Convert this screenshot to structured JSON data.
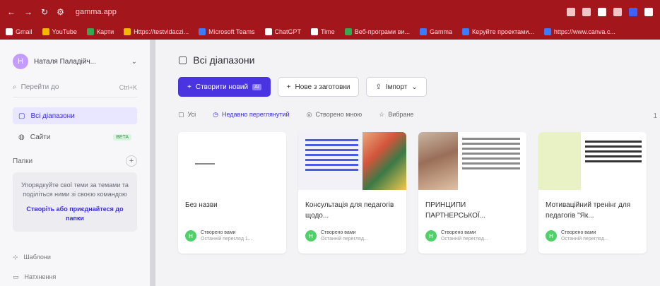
{
  "browser": {
    "tab_title": "gamma.app",
    "bookmarks": [
      "Gmail",
      "YouTube",
      "Карти",
      "Https://testvidaczi...",
      "Microsoft Teams",
      "ChatGPT",
      "Time",
      "Веб-програми ви...",
      "Gamma",
      "Керуйте проектами...",
      "https://www.canva.c..."
    ]
  },
  "sidebar": {
    "user_initial": "Н",
    "user_name": "Наталя Паладійч...",
    "search_placeholder": "Перейти до",
    "search_shortcut": "Ctrl+K",
    "nav": [
      {
        "label": "Всі діапазони",
        "active": true
      },
      {
        "label": "Сайти",
        "badge": "BETA"
      }
    ],
    "folders_label": "Папки",
    "folders_empty_text": "Упорядкуйте свої теми за темами та поділіться ними зі своєю командою",
    "folders_link": "Створіть або приєднайтеся до папки",
    "bottom": [
      {
        "label": "Шаблони"
      },
      {
        "label": "Натхнення"
      }
    ]
  },
  "main": {
    "title": "Всі діапазони",
    "buttons": {
      "create": "Створити новий",
      "create_tag": "AI",
      "template": "Нове з заготовки",
      "import": "Імпорт"
    },
    "filters": [
      {
        "label": "Усі",
        "active": false
      },
      {
        "label": "Недавно переглянутий",
        "active": true
      },
      {
        "label": "Створено мною",
        "active": false
      },
      {
        "label": "Вибране",
        "active": false
      }
    ],
    "page_edge": "1",
    "cards": [
      {
        "title": "Без назви",
        "meta_author": "Створено вами",
        "meta_sub": "Останній перегляд 1..."
      },
      {
        "title": "Консультація для педагогів щодо...",
        "meta_author": "Створено вами",
        "meta_sub": "Останній перегляд..."
      },
      {
        "title": "ПРИНЦИПИ ПАРТНЕРСЬКОЇ...",
        "meta_author": "Створено вами",
        "meta_sub": "Останній перегляд..."
      },
      {
        "title": "Мотиваційний тренінг для педагогів \"Як...",
        "meta_author": "Створено вами",
        "meta_sub": "Останній перегляд..."
      }
    ]
  },
  "colors": {
    "browser_red": "#a3161c",
    "accent": "#4a33e0",
    "active_bg": "#e9e6ff"
  }
}
